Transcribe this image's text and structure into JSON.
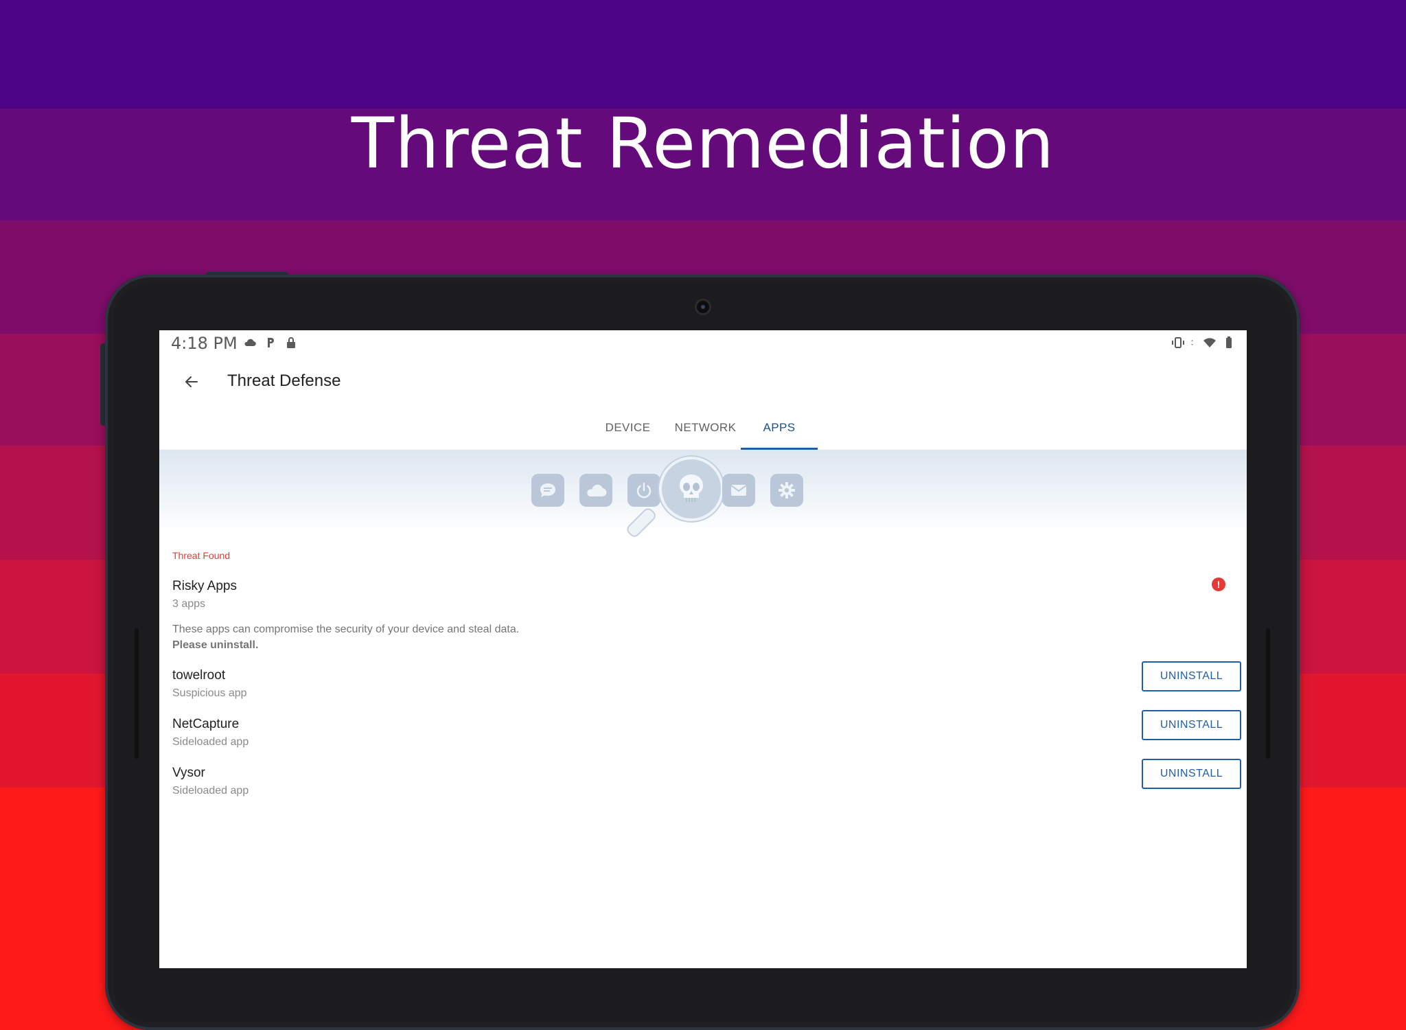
{
  "hero": {
    "title": "Threat Remediation"
  },
  "colors": {
    "bands": [
      "#4e0585",
      "#650a7a",
      "#7e0d6a",
      "#9a0f5c",
      "#b3124b",
      "#cb1440",
      "#e2172e",
      "#ff1a1a"
    ],
    "accent": "#1f5fa8",
    "threat": "#e53935"
  },
  "status_bar": {
    "time": "4:18 PM",
    "left_icons": [
      "cloud-icon",
      "p-icon",
      "lock-icon"
    ],
    "right_icons": [
      "vibrate-icon",
      "data-arrows-icon",
      "wifi-icon",
      "battery-icon"
    ]
  },
  "app_bar": {
    "title": "Threat Defense"
  },
  "tabs": [
    {
      "label": "DEVICE",
      "active": false
    },
    {
      "label": "NETWORK",
      "active": false
    },
    {
      "label": "APPS",
      "active": true
    }
  ],
  "hero_icons": [
    "chat-icon",
    "cloud-icon",
    "power-icon",
    "skull-magnifier-icon",
    "mail-icon",
    "gear-icon"
  ],
  "threat": {
    "section_label": "Threat Found",
    "title": "Risky Apps",
    "count": "3 apps",
    "description": "These apps can compromise the security of your device and steal data.",
    "instruction": "Please uninstall.",
    "alert_icon": "!"
  },
  "apps": [
    {
      "name": "towelroot",
      "type": "Suspicious app",
      "action": "UNINSTALL"
    },
    {
      "name": "NetCapture",
      "type": "Sideloaded app",
      "action": "UNINSTALL"
    },
    {
      "name": "Vysor",
      "type": "Sideloaded app",
      "action": "UNINSTALL"
    }
  ]
}
